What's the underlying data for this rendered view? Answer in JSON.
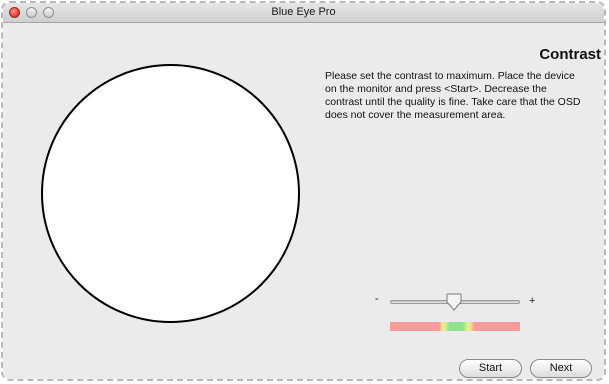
{
  "window": {
    "title": "Blue Eye Pro",
    "buttons": [
      "close",
      "minimize",
      "zoom"
    ]
  },
  "page": {
    "heading": "Contrast",
    "instructions": "Please set the contrast to maximum. Place the device on the monitor and press <Start>. Decrease the contrast until the quality is fine. Take care that the OSD does not cover the measurement area."
  },
  "measurement_area": {
    "shape": "circle",
    "fill_color": "#ffffff"
  },
  "contrast_slider": {
    "min_label": "-",
    "max_label": "+",
    "value_fraction": 0.49
  },
  "quality_indicator": {
    "colors": [
      "#f79a9a",
      "#f1e48a",
      "#8fe38f"
    ]
  },
  "actions": {
    "start_label": "Start",
    "next_label": "Next"
  }
}
